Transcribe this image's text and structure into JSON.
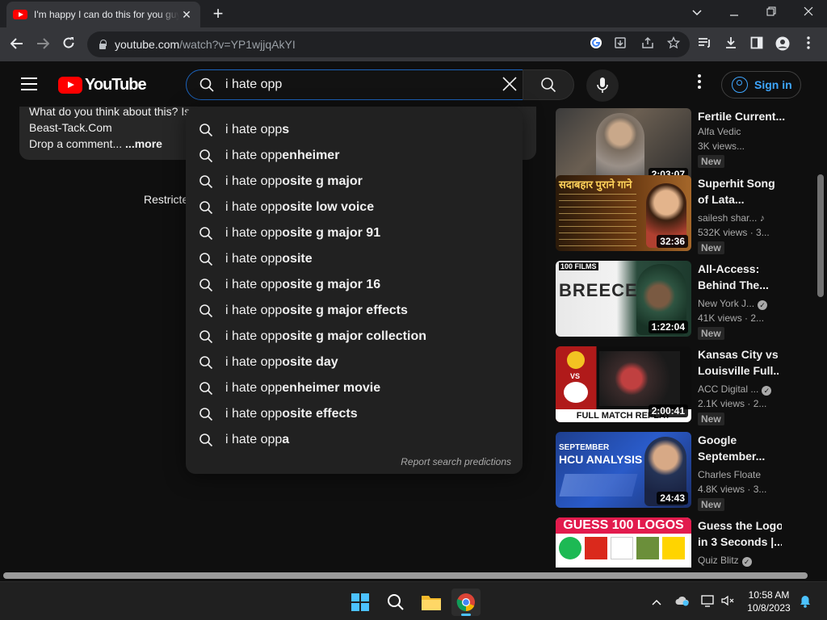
{
  "browser": {
    "tab_title": "I'm happy I can do this for you guys",
    "tab_close": "✕",
    "new_tab": "+",
    "url_host": "youtube.com",
    "url_path": "/watch?v=YP1wjjqAkYI"
  },
  "youtube": {
    "logo_text": "YouTube",
    "search_value": "i hate opp",
    "sign_in": "Sign in",
    "description": {
      "line1": "What do you think about this? Is",
      "line2": "Beast-Tack.Com",
      "line3_prefix": "Drop a comment... ",
      "more": "...more"
    },
    "restricted_text": "Restricte",
    "suggestions": [
      {
        "prefix": "i hate opp",
        "rest": "s"
      },
      {
        "prefix": "i hate opp",
        "rest": "enheimer"
      },
      {
        "prefix": "i hate opp",
        "rest": "osite g major"
      },
      {
        "prefix": "i hate opp",
        "rest": "osite low voice"
      },
      {
        "prefix": "i hate opp",
        "rest": "osite g major 91"
      },
      {
        "prefix": "i hate opp",
        "rest": "osite"
      },
      {
        "prefix": "i hate opp",
        "rest": "osite g major 16"
      },
      {
        "prefix": "i hate opp",
        "rest": "osite g major effects"
      },
      {
        "prefix": "i hate opp",
        "rest": "osite g major collection"
      },
      {
        "prefix": "i hate opp",
        "rest": "osite day"
      },
      {
        "prefix": "i hate opp",
        "rest": "enheimer movie"
      },
      {
        "prefix": "i hate opp",
        "rest": "osite effects"
      },
      {
        "prefix": "i hate opp",
        "rest": "a"
      }
    ],
    "report_link": "Report search predictions",
    "sidebar": [
      {
        "title1": "Fertile Current...",
        "title2": "",
        "channel": "Alfa Vedic",
        "views": "3K views...",
        "duration": "2:03:07",
        "badge": "New",
        "verified": false
      },
      {
        "title1": "Superhit Song",
        "title2": "of Lata...",
        "channel": "sailesh shar...",
        "views": "532K views · 3...",
        "duration": "32:36",
        "badge": "New",
        "verified": false,
        "thumb_text": "सदाबहार पुराने गाने"
      },
      {
        "title1": "All-Access:",
        "title2": "Behind The...",
        "channel": "New York J...",
        "views": "41K views · 2...",
        "duration": "1:22:04",
        "badge": "New",
        "verified": true,
        "thumb_text": "BREECE",
        "thumb_tag": "100 FILMS"
      },
      {
        "title1": "Kansas City vs.",
        "title2": "Louisville Full...",
        "channel": "ACC Digital ...",
        "views": "2.1K views · 2...",
        "duration": "2:00:41",
        "badge": "New",
        "verified": true,
        "thumb_text": "FULL MATCH REPLAY",
        "thumb_vs": "VS"
      },
      {
        "title1": "Google",
        "title2": "September...",
        "channel": "Charles Floate",
        "views": "4.8K views · 3...",
        "duration": "24:43",
        "badge": "New",
        "verified": false,
        "thumb_text": "HCU ANALYSIS",
        "thumb_tag": "SEPTEMBER"
      },
      {
        "title1": "Guess the Logo",
        "title2": "in 3 Seconds |...",
        "channel": "Quiz Blitz",
        "views": "",
        "duration": "",
        "badge": "",
        "verified": true,
        "thumb_text": "GUESS 100 LOGOS"
      }
    ]
  },
  "taskbar": {
    "time": "10:58 AM",
    "date": "10/8/2023"
  },
  "colors": {
    "accent_blue": "#3ea6ff",
    "youtube_red": "#ff0000",
    "page_bg": "#0f0f0f"
  }
}
